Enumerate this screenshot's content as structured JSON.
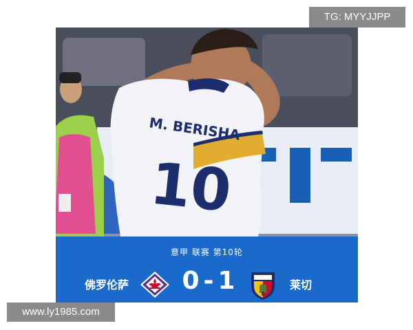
{
  "watermarks": {
    "top_right": "TG: MYYJJPP",
    "bottom_left": "www.ly1985.com"
  },
  "match": {
    "round_label": "意甲 联赛 第10轮",
    "home_team": "佛罗伦萨",
    "away_team": "莱切",
    "home_score": "0",
    "separator": "-",
    "away_score": "1",
    "home_crest_icon": "fiorentina-crest-icon",
    "away_crest_icon": "lecce-crest-icon"
  },
  "photo": {
    "jersey_name": "M. BERISHA",
    "jersey_number": "10"
  },
  "colors": {
    "card_blue": "#1a6acb",
    "fiorentina_purple": "#5b2d8f",
    "lecce_yellow": "#f2c21a",
    "lecce_red": "#c8102e"
  }
}
